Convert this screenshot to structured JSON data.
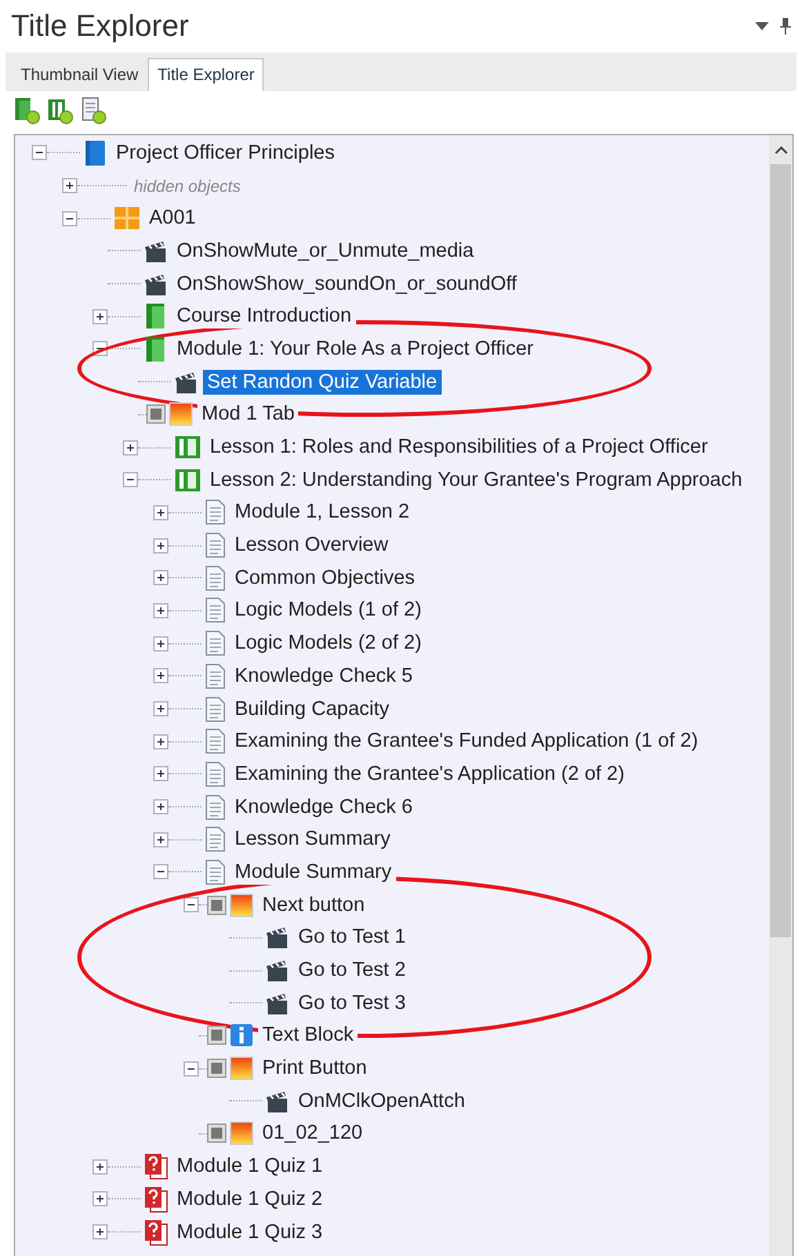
{
  "panel": {
    "title": "Title Explorer"
  },
  "tabs": [
    {
      "label": "Thumbnail View",
      "selected": false
    },
    {
      "label": "Title Explorer",
      "selected": true
    }
  ],
  "tree": [
    {
      "label": "Project Officer Principles",
      "kind": "book",
      "expanded": true,
      "selected": false,
      "children": [
        {
          "label": "hidden objects",
          "kind": "hidden",
          "expanded": false,
          "selected": false
        },
        {
          "label": "A001",
          "kind": "folder",
          "expanded": true,
          "selected": false,
          "children": [
            {
              "label": "OnShowMute_or_Unmute_media",
              "kind": "action",
              "selected": false
            },
            {
              "label": "OnShowShow_soundOn_or_soundOff",
              "kind": "action",
              "selected": false
            },
            {
              "label": "Course Introduction",
              "kind": "chapter",
              "expanded": false,
              "selected": false
            },
            {
              "label": "Module 1: Your Role As a Project Officer",
              "kind": "chapter",
              "expanded": true,
              "selected": false,
              "circled": true,
              "children": [
                {
                  "label": "Set Randon Quiz Variable",
                  "kind": "action",
                  "selected": true,
                  "circled": true
                },
                {
                  "label": "Mod 1 Tab",
                  "kind": "object",
                  "selected": false
                },
                {
                  "label": "Lesson 1: Roles and Responsibilities of a Project Officer",
                  "kind": "lesson",
                  "expanded": false,
                  "selected": false
                },
                {
                  "label": "Lesson 2: Understanding Your Grantee's Program Approach",
                  "kind": "lesson",
                  "expanded": true,
                  "selected": false,
                  "children": [
                    {
                      "label": "Module 1, Lesson 2",
                      "kind": "page",
                      "expanded": false,
                      "selected": false
                    },
                    {
                      "label": "Lesson Overview",
                      "kind": "page",
                      "expanded": false,
                      "selected": false
                    },
                    {
                      "label": "Common Objectives",
                      "kind": "page",
                      "expanded": false,
                      "selected": false
                    },
                    {
                      "label": "Logic Models (1 of 2)",
                      "kind": "page",
                      "expanded": false,
                      "selected": false
                    },
                    {
                      "label": "Logic Models (2 of 2)",
                      "kind": "page",
                      "expanded": false,
                      "selected": false
                    },
                    {
                      "label": "Knowledge Check 5",
                      "kind": "page",
                      "expanded": false,
                      "selected": false
                    },
                    {
                      "label": "Building Capacity",
                      "kind": "page",
                      "expanded": false,
                      "selected": false
                    },
                    {
                      "label": "Examining the Grantee's Funded Application (1 of 2)",
                      "kind": "page",
                      "expanded": false,
                      "selected": false
                    },
                    {
                      "label": "Examining the Grantee's Application (2 of 2)",
                      "kind": "page",
                      "expanded": false,
                      "selected": false
                    },
                    {
                      "label": "Knowledge Check 6",
                      "kind": "page",
                      "expanded": false,
                      "selected": false
                    },
                    {
                      "label": "Lesson Summary",
                      "kind": "page",
                      "expanded": false,
                      "selected": false
                    },
                    {
                      "label": "Module Summary",
                      "kind": "page",
                      "expanded": true,
                      "selected": false,
                      "children": [
                        {
                          "label": "Next button",
                          "kind": "object",
                          "expanded": true,
                          "selected": false,
                          "circled": true,
                          "children": [
                            {
                              "label": "Go to Test 1",
                              "kind": "action",
                              "selected": false,
                              "circled": true
                            },
                            {
                              "label": "Go to Test 2",
                              "kind": "action",
                              "selected": false,
                              "circled": true
                            },
                            {
                              "label": "Go to Test 3",
                              "kind": "action",
                              "selected": false,
                              "circled": true
                            }
                          ]
                        },
                        {
                          "label": "Text Block",
                          "kind": "info",
                          "selected": false
                        },
                        {
                          "label": "Print Button",
                          "kind": "object",
                          "expanded": true,
                          "selected": false,
                          "children": [
                            {
                              "label": "OnMClkOpenAttch",
                              "kind": "action",
                              "selected": false
                            }
                          ]
                        },
                        {
                          "label": "01_02_120",
                          "kind": "object",
                          "selected": false
                        }
                      ]
                    }
                  ]
                }
              ]
            },
            {
              "label": "Module 1 Quiz 1",
              "kind": "quiz",
              "expanded": false,
              "selected": false
            },
            {
              "label": "Module 1 Quiz 2",
              "kind": "quiz",
              "expanded": false,
              "selected": false
            },
            {
              "label": "Module 1 Quiz 3",
              "kind": "quiz",
              "expanded": false,
              "selected": false
            }
          ]
        }
      ]
    }
  ]
}
